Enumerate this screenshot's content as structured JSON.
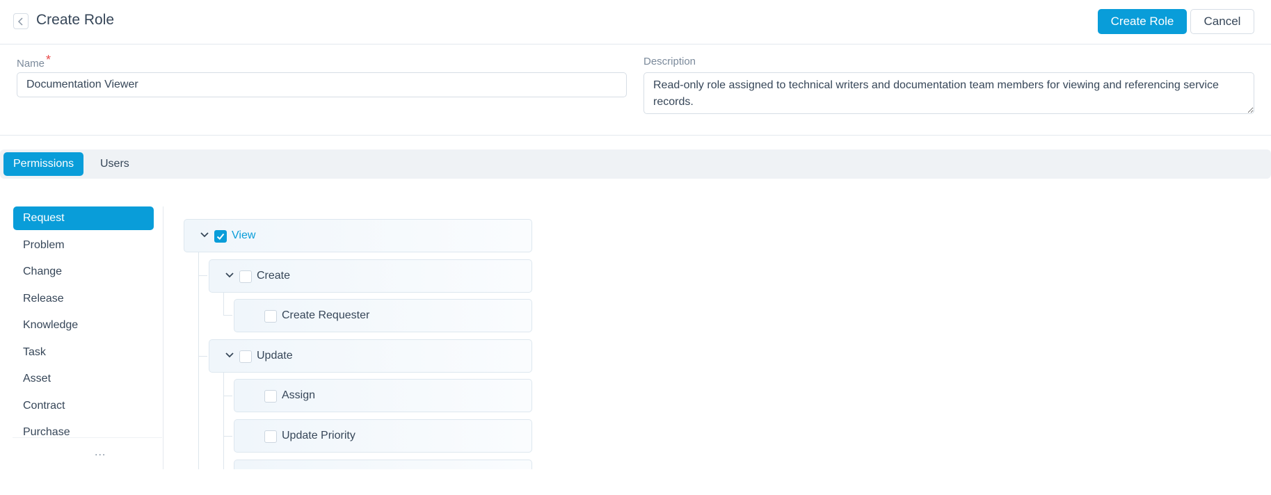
{
  "header": {
    "title": "Create Role",
    "create_button": "Create Role",
    "cancel_button": "Cancel"
  },
  "form": {
    "name_label": "Name",
    "required_marker": "*",
    "name_value": "Documentation Viewer",
    "description_label": "Description",
    "description_value": "Read-only role assigned to technical writers and documentation team members for viewing and referencing service records."
  },
  "tabs": [
    {
      "label": "Permissions",
      "active": true
    },
    {
      "label": "Users",
      "active": false
    }
  ],
  "sidebar": {
    "items": [
      {
        "label": "Request",
        "active": true
      },
      {
        "label": "Problem"
      },
      {
        "label": "Change"
      },
      {
        "label": "Release"
      },
      {
        "label": "Knowledge"
      },
      {
        "label": "Task"
      },
      {
        "label": "Asset"
      },
      {
        "label": "Contract"
      },
      {
        "label": "Purchase"
      }
    ],
    "more": "..."
  },
  "permissions": {
    "view": {
      "label": "View",
      "checked": true
    },
    "create": {
      "label": "Create",
      "checked": false
    },
    "create_requester": {
      "label": "Create Requester",
      "checked": false
    },
    "update": {
      "label": "Update",
      "checked": false
    },
    "assign": {
      "label": "Assign",
      "checked": false
    },
    "update_priority": {
      "label": "Update Priority",
      "checked": false
    }
  },
  "colors": {
    "accent": "#099dd9",
    "text": "#364658",
    "muted": "#7b8a9b",
    "required": "#e94a4a"
  }
}
